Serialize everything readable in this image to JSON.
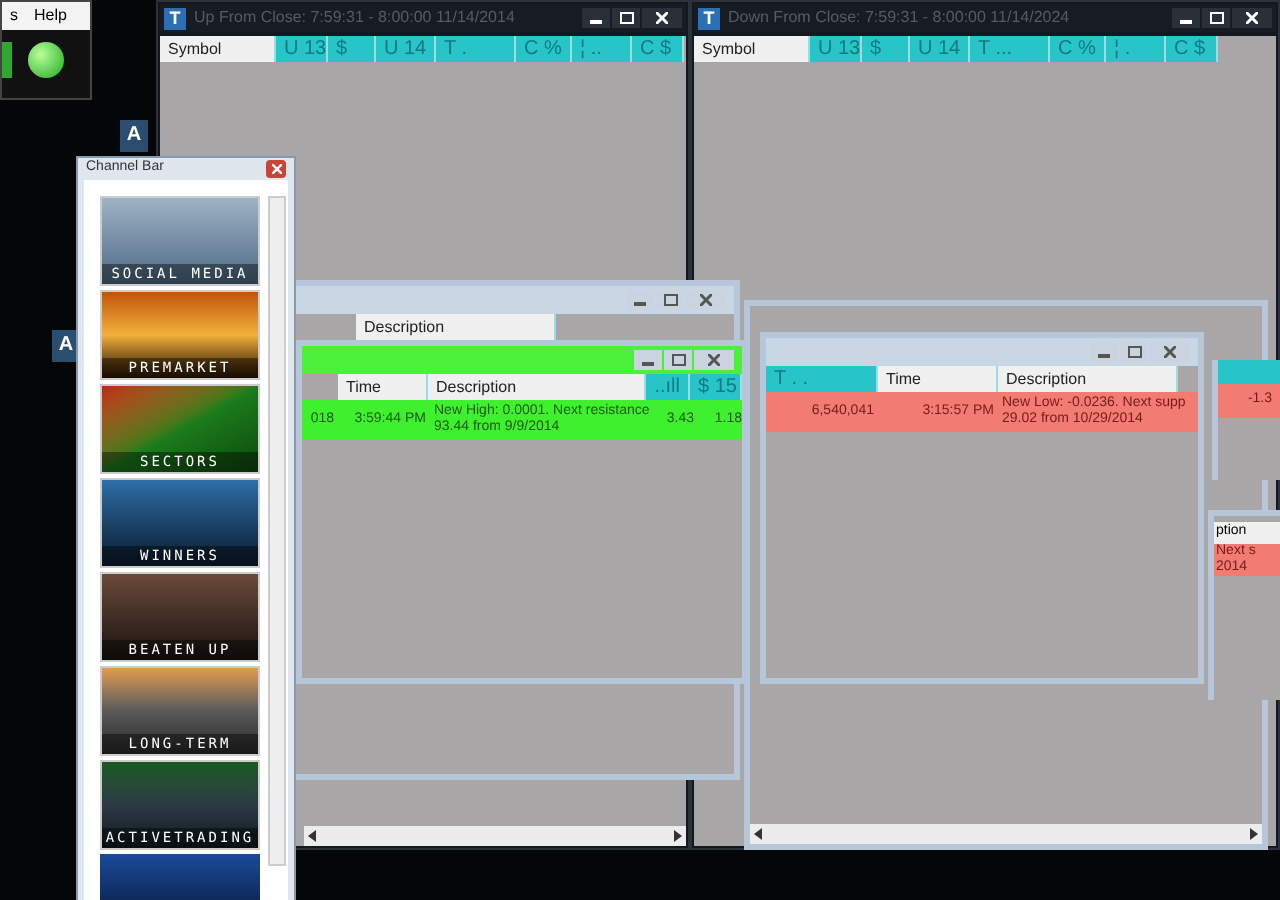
{
  "top_window": {
    "menu": [
      "s",
      "Help"
    ]
  },
  "windows": [
    {
      "logo": "T",
      "title": "Up From Close:  7:59:31 - 8:00:00   11/14/2014",
      "columns": [
        {
          "label": "Symbol",
          "kind": "plain"
        },
        {
          "label": "U 13",
          "kind": "teal"
        },
        {
          "label": "$",
          "kind": "teal"
        },
        {
          "label": "U 14",
          "kind": "teal"
        },
        {
          "label": "T .",
          "kind": "teal"
        },
        {
          "label": "C %",
          "kind": "teal"
        },
        {
          "label": "¦ ..",
          "kind": "teal"
        },
        {
          "label": "C $",
          "kind": "teal"
        }
      ]
    },
    {
      "logo": "T",
      "title": "Down From Close:  7:59:31 - 8:00:00   11/14/2024",
      "columns": [
        {
          "label": "Symbol",
          "kind": "plain"
        },
        {
          "label": "U 13",
          "kind": "teal"
        },
        {
          "label": "$",
          "kind": "teal"
        },
        {
          "label": "U 14",
          "kind": "teal"
        },
        {
          "label": "T ...",
          "kind": "teal"
        },
        {
          "label": "C %",
          "kind": "teal"
        },
        {
          "label": "¦ .",
          "kind": "teal"
        },
        {
          "label": "C $",
          "kind": "teal"
        }
      ]
    }
  ],
  "side_tabs": [
    "A",
    "A"
  ],
  "channel_bar": {
    "title": "Channel Bar",
    "items": [
      "SOCIAL MEDIA",
      "PREMARKET",
      "SECTORS",
      "WINNERS",
      "BEATEN UP",
      "LONG-TERM",
      "ACTIVETRADING"
    ]
  },
  "back_window": {
    "columns": [
      "Description"
    ]
  },
  "alerts": [
    {
      "kind": "high",
      "columns": [
        {
          "label": "Time",
          "kind": "plain"
        },
        {
          "label": "Description",
          "kind": "plain"
        },
        {
          "label": "..ıll",
          "kind": "teal"
        },
        {
          "label": "$ 15",
          "kind": "teal"
        }
      ],
      "cells": [
        "018",
        "3:59:44 PM",
        "New High: 0.0001. Next resistance 93.44 from 9/9/2014",
        "3.43",
        "1.18"
      ]
    },
    {
      "kind": "low",
      "columns": [
        {
          "label": "T . .",
          "kind": "teal"
        },
        {
          "label": "Time",
          "kind": "plain"
        },
        {
          "label": "Description",
          "kind": "plain"
        }
      ],
      "cells": [
        "6,540,041",
        "3:15:57 PM",
        "New Low: -0.0236. Next supp 29.02 from 10/29/2014"
      ]
    }
  ],
  "right_edge": {
    "value": "-1.3",
    "column": "ption",
    "cells": [
      "Next s",
      "2014"
    ]
  }
}
